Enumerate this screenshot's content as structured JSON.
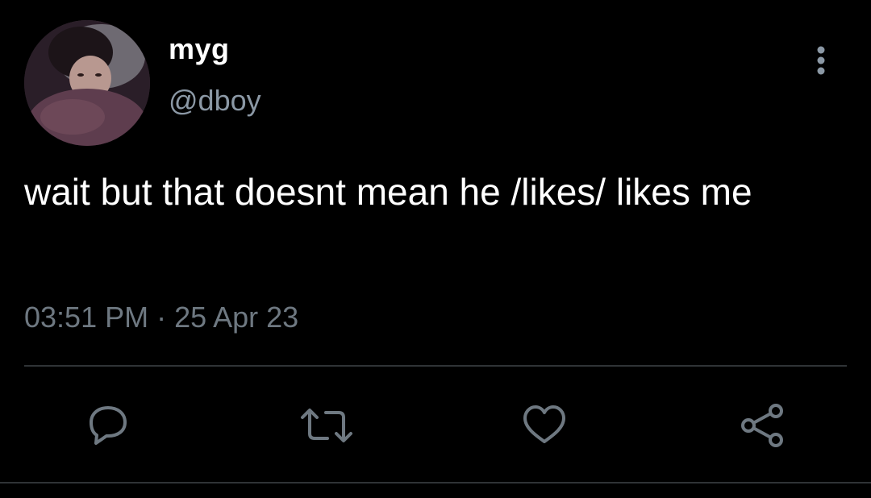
{
  "user": {
    "display_name": "myg",
    "handle": "@dboy"
  },
  "tweet": {
    "text": "wait but that doesnt mean he /likes/ likes me",
    "timestamp": "03:51 PM · 25 Apr 23"
  },
  "actions": [
    {
      "name": "reply",
      "icon": "reply-icon"
    },
    {
      "name": "retweet",
      "icon": "retweet-icon"
    },
    {
      "name": "like",
      "icon": "heart-icon"
    },
    {
      "name": "share",
      "icon": "share-icon"
    }
  ],
  "colors": {
    "background": "#000000",
    "text": "#ffffff",
    "secondary_text": "#8b98a5",
    "icon": "#6e7881",
    "divider": "#2f3336"
  }
}
